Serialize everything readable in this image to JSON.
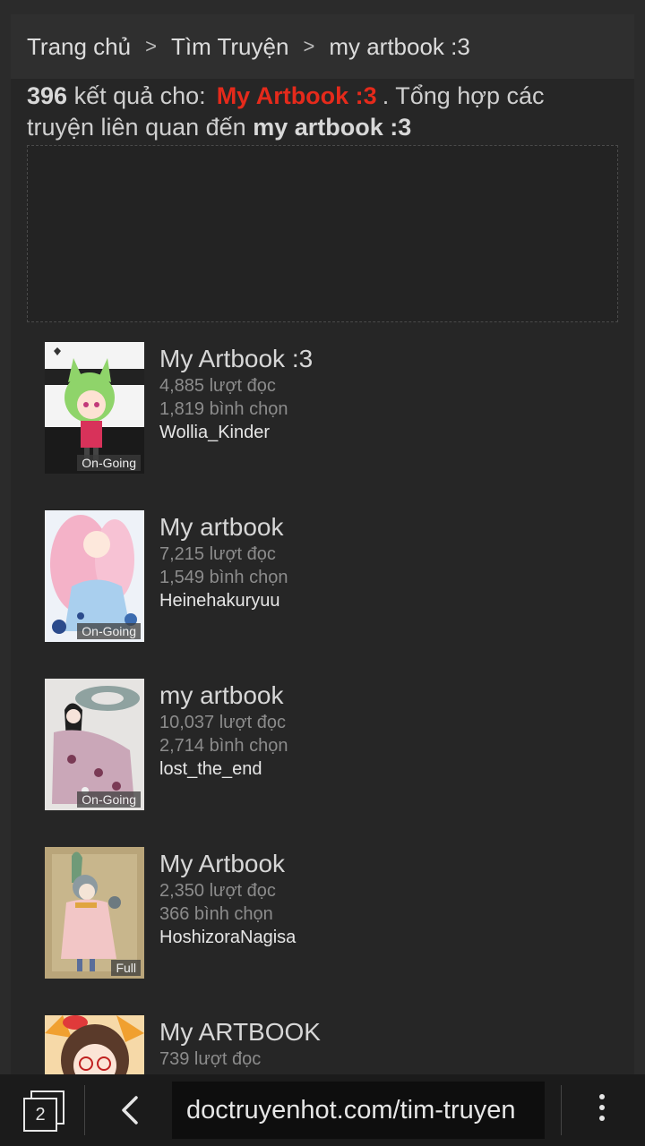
{
  "breadcrumb": {
    "home": "Trang chủ",
    "search": "Tìm Truyện",
    "current": "my artbook :3",
    "separator": ">"
  },
  "results": {
    "count": "396",
    "for_text": "kết quả cho:",
    "keyword": "My Artbook :3",
    "summary": ". Tổng hợp các truyện liên quan đến",
    "keyword_bold": "my artbook :3",
    "keyword_color": "#e52a1b"
  },
  "stories": [
    {
      "title": "My Artbook :3",
      "reads": "4,885 lượt đọc",
      "votes": "1,819 bình chọn",
      "author": "Wollia_Kinder",
      "status": "On-Going"
    },
    {
      "title": "My artbook",
      "reads": "7,215 lượt đọc",
      "votes": "1,549 bình chọn",
      "author": "Heinehakuryuu",
      "status": "On-Going"
    },
    {
      "title": "my artbook",
      "reads": "10,037 lượt đọc",
      "votes": "2,714 bình chọn",
      "author": "lost_the_end",
      "status": "On-Going"
    },
    {
      "title": "My Artbook",
      "reads": "2,350 lượt đọc",
      "votes": "366 bình chọn",
      "author": "HoshizoraNagisa",
      "status": "Full"
    },
    {
      "title": "My ARTBOOK",
      "reads": "739 lượt đọc",
      "votes": "",
      "author": "",
      "status": ""
    }
  ],
  "bottombar": {
    "tab_count": "2",
    "url": "doctruyenhot.com/tim-truyen",
    "back_icon": "chevron-left-icon",
    "menu_icon": "more-vert-icon",
    "tabs_icon": "tabs-icon"
  }
}
